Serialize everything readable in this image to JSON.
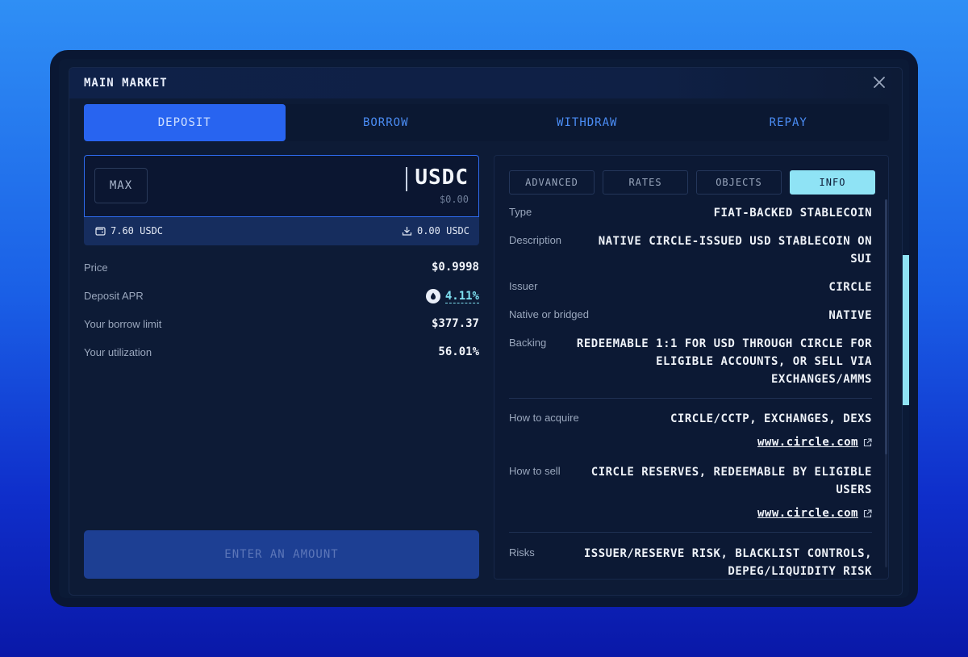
{
  "modal": {
    "title": "MAIN MARKET"
  },
  "tabs": [
    {
      "label": "DEPOSIT",
      "active": true
    },
    {
      "label": "BORROW",
      "active": false
    },
    {
      "label": "WITHDRAW",
      "active": false
    },
    {
      "label": "REPAY",
      "active": false
    }
  ],
  "amount": {
    "max_label": "MAX",
    "token": "USDC",
    "usd_value": "$0.00",
    "wallet_balance": "7.60 USDC",
    "deposited_balance": "0.00 USDC"
  },
  "stats": [
    {
      "label": "Price",
      "value": "$0.9998"
    },
    {
      "label": "Deposit APR",
      "value": "4.11%"
    },
    {
      "label": "Your borrow limit",
      "value": "$377.37"
    },
    {
      "label": "Your utilization",
      "value": "56.01%"
    }
  ],
  "submit": {
    "label": "ENTER AN AMOUNT"
  },
  "info_tabs": [
    {
      "label": "ADVANCED",
      "active": false
    },
    {
      "label": "RATES",
      "active": false
    },
    {
      "label": "OBJECTS",
      "active": false
    },
    {
      "label": "INFO",
      "active": true
    }
  ],
  "info": {
    "type": {
      "label": "Type",
      "value": "FIAT-BACKED STABLECOIN"
    },
    "description": {
      "label": "Description",
      "value_l1": "NATIVE CIRCLE-ISSUED USD STABLECOIN ON",
      "value_l2": "SUI"
    },
    "issuer": {
      "label": "Issuer",
      "value": "CIRCLE"
    },
    "native": {
      "label": "Native or bridged",
      "value": "NATIVE"
    },
    "backing": {
      "label": "Backing",
      "value_l1": "REDEEMABLE 1:1 FOR USD THROUGH CIRCLE FOR",
      "value_l2": "ELIGIBLE ACCOUNTS, OR SELL VIA",
      "value_l3": "EXCHANGES/AMMS"
    },
    "acquire": {
      "label": "How to acquire",
      "value": "CIRCLE/CCTP, EXCHANGES, DEXS",
      "link": "www.circle.com"
    },
    "sell": {
      "label": "How to sell",
      "value_l1": "CIRCLE RESERVES, REDEEMABLE BY ELIGIBLE",
      "value_l2": "USERS",
      "link": "www.circle.com"
    },
    "risks": {
      "label": "Risks",
      "value_l1": "ISSUER/RESERVE RISK, BLACKLIST CONTROLS,",
      "value_l2": "DEPEG/LIQUIDITY RISK"
    }
  },
  "colors": {
    "accent": "#2864f0",
    "info_active": "#8fe3f5",
    "apr": "#7fe0f0"
  },
  "icons": {
    "close": "close-icon",
    "wallet": "wallet-icon",
    "download": "download-icon",
    "sui": "sui-drop-icon",
    "external": "external-link-icon"
  }
}
